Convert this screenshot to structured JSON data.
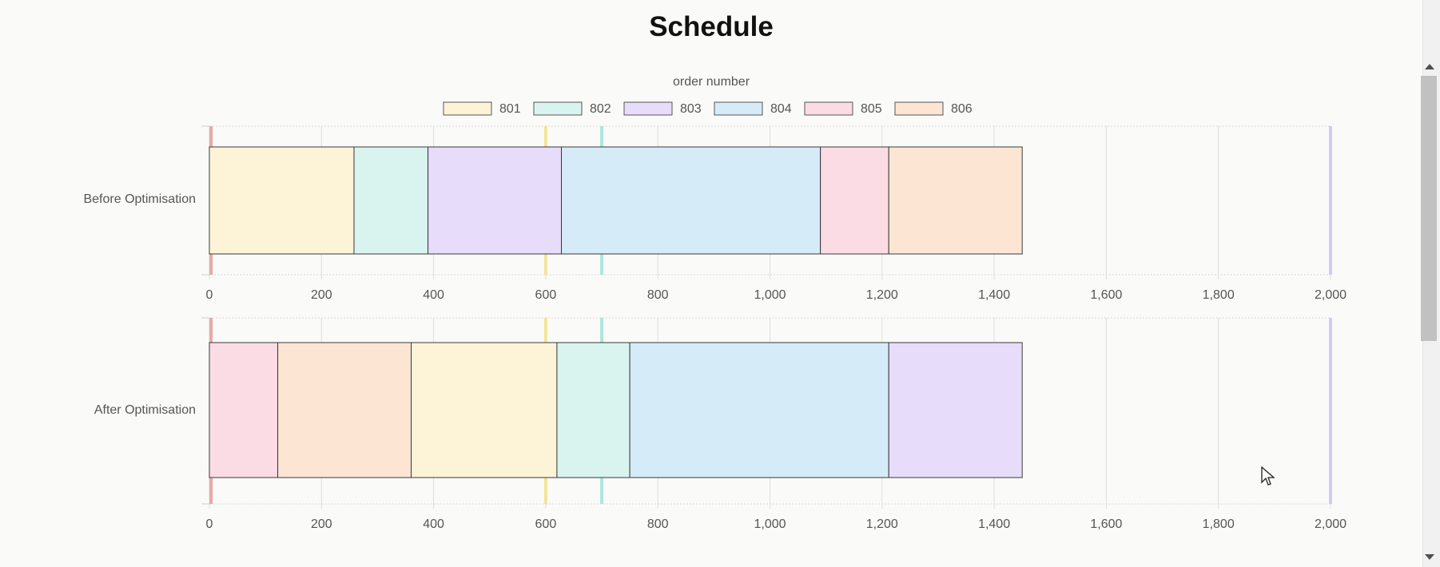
{
  "chart_data": {
    "type": "bar",
    "orientation": "horizontal",
    "stacked": true,
    "title": "Schedule",
    "legend_title": "order number",
    "legend_position": "top",
    "xlim": [
      0,
      2000
    ],
    "x_ticks": [
      "0",
      "200",
      "400",
      "600",
      "800",
      "1,000",
      "1,200",
      "1,400",
      "1,600",
      "1,800",
      "2,000"
    ],
    "grid": true,
    "orders": [
      {
        "name": "801",
        "fill": "#fdf3d6",
        "line": "#f5d36b"
      },
      {
        "name": "802",
        "fill": "#d9f4ee",
        "line": "#7fd8c6"
      },
      {
        "name": "803",
        "fill": "#e8dcfb",
        "line": "#b99bf0"
      },
      {
        "name": "804",
        "fill": "#d6ebf8",
        "line": "#82c4ea"
      },
      {
        "name": "805",
        "fill": "#fbdbe4",
        "line": "#f08fab"
      },
      {
        "name": "806",
        "fill": "#fce6d3",
        "line": "#f3b98a"
      }
    ],
    "reference_lines": [
      {
        "value": 3,
        "color": "#e59a9a"
      },
      {
        "value": 600,
        "color": "#f2e08a"
      },
      {
        "value": 700,
        "color": "#9fe3d8"
      },
      {
        "value": 2000,
        "color": "#c9c3f2"
      }
    ],
    "panels": [
      {
        "label": "Before Optimisation",
        "segments": [
          {
            "order": "801",
            "start": 0,
            "end": 258
          },
          {
            "order": "802",
            "start": 258,
            "end": 390
          },
          {
            "order": "803",
            "start": 390,
            "end": 628
          },
          {
            "order": "804",
            "start": 628,
            "end": 1090
          },
          {
            "order": "805",
            "start": 1090,
            "end": 1212
          },
          {
            "order": "806",
            "start": 1212,
            "end": 1450
          }
        ]
      },
      {
        "label": "After Optimisation",
        "segments": [
          {
            "order": "805",
            "start": 0,
            "end": 122
          },
          {
            "order": "806",
            "start": 122,
            "end": 360
          },
          {
            "order": "801",
            "start": 360,
            "end": 620
          },
          {
            "order": "802",
            "start": 620,
            "end": 750
          },
          {
            "order": "804",
            "start": 750,
            "end": 1212
          },
          {
            "order": "803",
            "start": 1212,
            "end": 1450
          }
        ]
      }
    ]
  }
}
